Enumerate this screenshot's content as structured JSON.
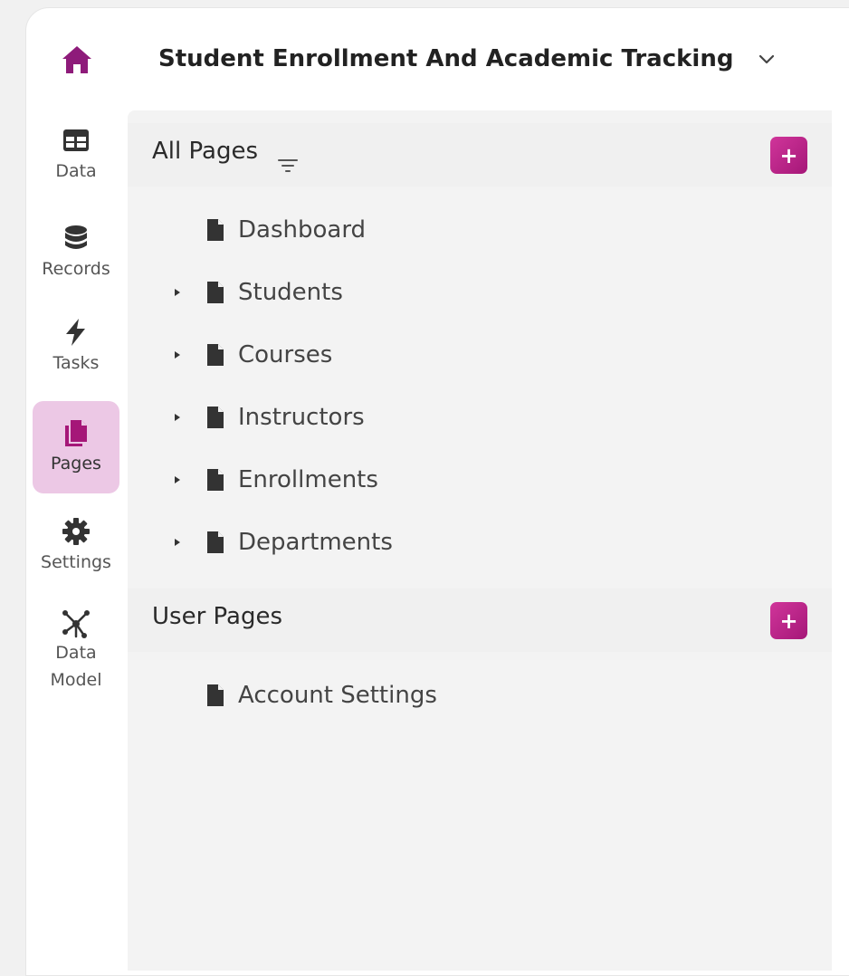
{
  "header": {
    "title": "Student Enrollment And Academic Tracking"
  },
  "rail": {
    "items": [
      {
        "label": "Data"
      },
      {
        "label": "Records"
      },
      {
        "label": "Tasks"
      },
      {
        "label": "Pages"
      },
      {
        "label": "Settings"
      },
      {
        "label": "Data\nModel"
      }
    ],
    "active": "Pages"
  },
  "all_pages": {
    "title": "All Pages",
    "items": [
      {
        "label": "Dashboard",
        "expandable": false
      },
      {
        "label": "Students",
        "expandable": true
      },
      {
        "label": "Courses",
        "expandable": true
      },
      {
        "label": "Instructors",
        "expandable": true
      },
      {
        "label": "Enrollments",
        "expandable": true
      },
      {
        "label": "Departments",
        "expandable": true
      }
    ]
  },
  "user_pages": {
    "title": "User Pages",
    "items": [
      {
        "label": "Account Settings",
        "expandable": false
      }
    ]
  },
  "buttons": {
    "add_symbol": "+"
  },
  "colors": {
    "accent": "#b5207f",
    "active_bg": "#ecc8e5",
    "home_icon": "#8e1b7a"
  }
}
